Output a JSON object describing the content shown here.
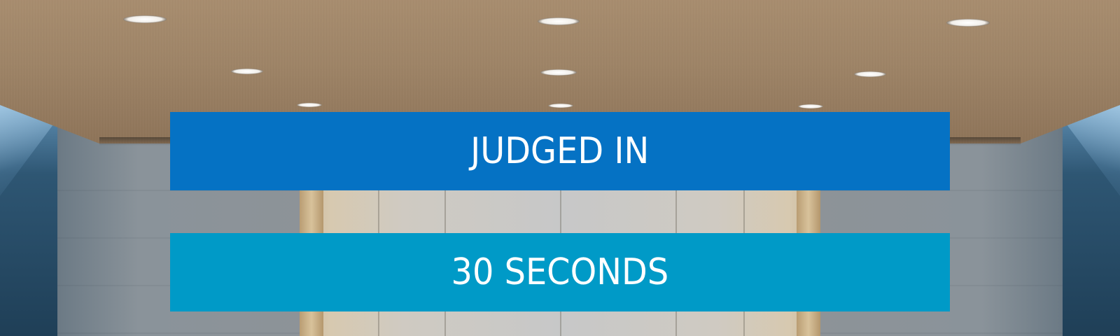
{
  "banners": {
    "top": {
      "text": "JUDGED IN",
      "background": "#0572c4"
    },
    "bottom": {
      "text": "30 SECONDS",
      "background": "#009ac7"
    }
  },
  "text_color": "#ffffff",
  "background_photo": "building lobby with wooden ceiling, recessed lights, elevator bay and blue glass side windows"
}
